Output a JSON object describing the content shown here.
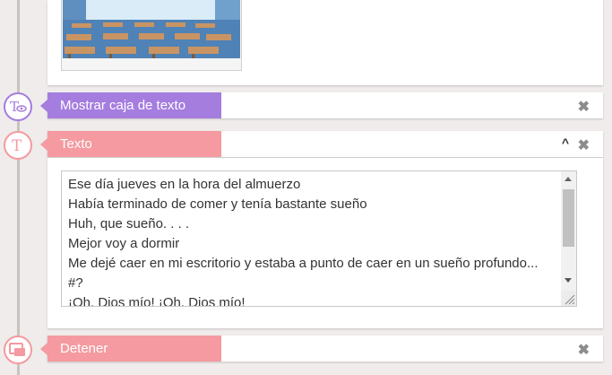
{
  "image_node": {
    "thumbnail_alt": "classroom background"
  },
  "nodes": {
    "show_textbox": {
      "label": "Mostrar caja de texto",
      "icon": "textbox-eye-icon",
      "color": "#a57ddf"
    },
    "text": {
      "label": "Texto",
      "icon": "text-t-icon",
      "color": "#f49aa0"
    },
    "stop": {
      "label": "Detener",
      "icon": "stop-window-icon",
      "color": "#f49aa0"
    }
  },
  "text_content": {
    "lines": [
      "Ese día jueves en la hora del almuerzo",
      "Había terminado de comer y tenía bastante sueño",
      "Huh, que sueño. . . .",
      "Mejor voy a dormir",
      "Me dejé caer en mi escritorio y estaba a punto de caer en un sueño profundo...",
      "#?",
      "¡Oh, Dios mío! ¡Oh, Dios mío!"
    ]
  },
  "controls": {
    "close_glyph": "✖",
    "collapse_glyph": "^"
  }
}
